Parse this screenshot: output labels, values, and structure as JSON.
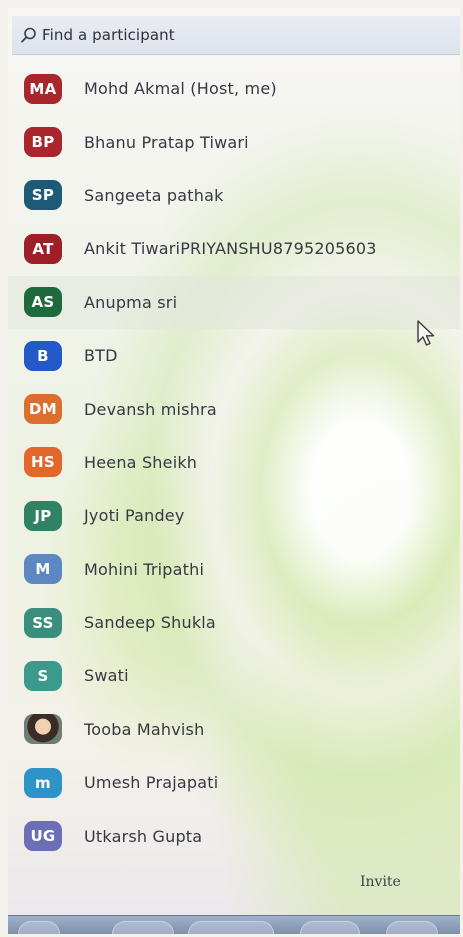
{
  "search": {
    "placeholder": "Find a participant"
  },
  "participants": [
    {
      "initials": "MA",
      "name": "Mohd Akmal (Host, me)",
      "color": "#a8262c"
    },
    {
      "initials": "BP",
      "name": "Bhanu Pratap Tiwari",
      "color": "#a8262c"
    },
    {
      "initials": "SP",
      "name": "Sangeeta pathak",
      "color": "#1d5a78"
    },
    {
      "initials": "AT",
      "name": "Ankit TiwariPRIYANSHU8795205603",
      "color": "#9e1f28"
    },
    {
      "initials": "AS",
      "name": "Anupma sri",
      "color": "#1f6a3c"
    },
    {
      "initials": "B",
      "name": "BTD",
      "color": "#2459c8"
    },
    {
      "initials": "DM",
      "name": "Devansh mishra",
      "color": "#dd6f2c"
    },
    {
      "initials": "HS",
      "name": "Heena Sheikh",
      "color": "#e3672a"
    },
    {
      "initials": "JP",
      "name": "Jyoti Pandey",
      "color": "#2f8264"
    },
    {
      "initials": "M",
      "name": "Mohini Tripathi",
      "color": "#5c87c2"
    },
    {
      "initials": "SS",
      "name": "Sandeep Shukla",
      "color": "#3b8e7e"
    },
    {
      "initials": "S",
      "name": "Swati",
      "color": "#3b9a8c"
    },
    {
      "initials": "",
      "name": "Tooba Mahvish",
      "color": "#6f7d74",
      "photo": true
    },
    {
      "initials": "m",
      "name": "Umesh Prajapati",
      "color": "#2e93c7"
    },
    {
      "initials": "UG",
      "name": "Utkarsh Gupta",
      "color": "#6b6fb5"
    }
  ],
  "invite": {
    "label": "Invite"
  }
}
